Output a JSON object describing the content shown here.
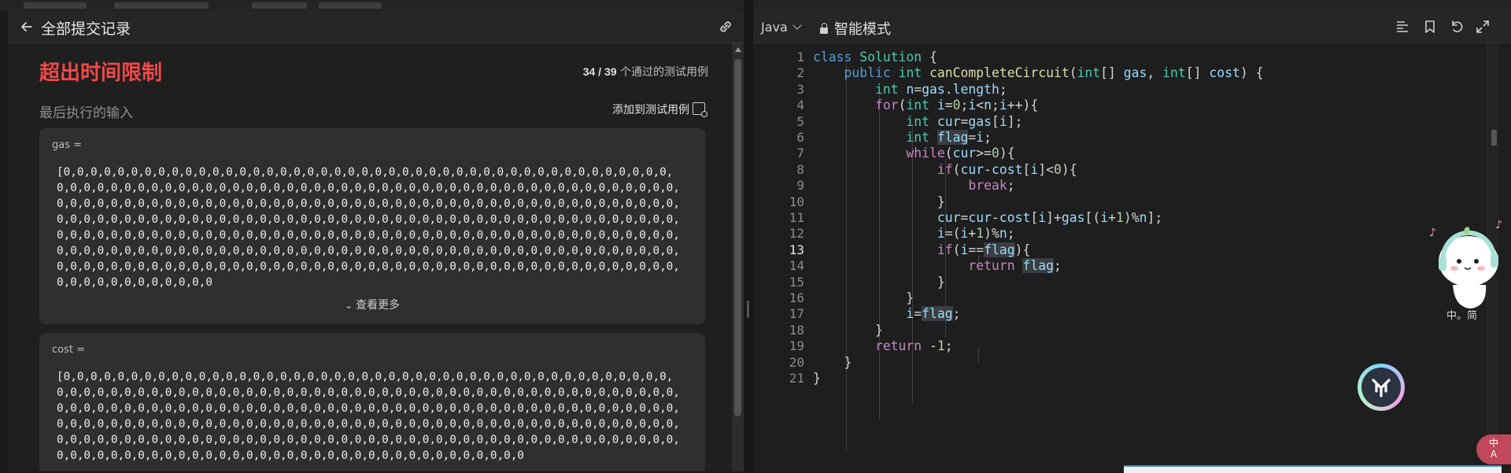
{
  "left": {
    "title": "全部提交记录",
    "verdict": "超出时间限制",
    "passed": "34 / 39",
    "passed_suffix": " 个通过的测试用例",
    "last_input_label": "最后执行的输入",
    "add_case_label": "添加到测试用例",
    "inputs": [
      {
        "name": "gas =",
        "value_prefix": "[0,0,0,0,0,0,0,0,0,0,0,0,0,0,0,0,0,0,0,0,0,0,0,0,0,0,0,0,0,0,0,0,0,0,0,0,0,0,0,0,0,0,0,0,0,0,0,0,0,0,0,0,0,0,0,0,0,0,0,0,0,0,0,0,0,0,0,0,0,0,0,0,0,0,0,0,0,0,0,0,0,0,0,0,0,0,0,0,0,0,0,0,0,0,0,0,0,0,0,0,0,0,0,0,0,0,0,0,0,0,0,0,0,0,0,0,0,0,0,0,0,0,0,0,0,0,0,0,0,0,0,0,0,0,0,0,0,0,0,0,0,0,0,0,0,0,0,0,0,0,0,0,0,0,0,0,0,0,0,0,0,0,0,0,0,0,0,0,0,0,0,0,0,0,0,0,0,0,0,0,0,0,0,0,0,0,0,0,0,0,0,0,0,0,0,0,0,0,0,0,0,0,0,0,0,0,0,0,0,0,0,0,0,0,0,0,0,0,0,0,0,0,0,0,0,0,0,0,0,0,0,0,0,0,0,0,0,0,0,0,0,0,0,0,0,0,0,0,0,0,0,0,0,0,0,0,0,0,0,0,0,0,0,0,0,0,0,0,0,0,0,0,0,0,0,0,0,0,0,0,0,0,0,0,0,0,0,0,0,0,0,0,0,0,0,0,0,0,0,0,0,0,0,0,0,0,0,0,0,0,0,0,0,0,0,0,0,0,0,0,0,0,0,0,0,0,0,0,0,0,0,0,0"
      },
      {
        "name": "cost =",
        "value_prefix": "[0,0,0,0,0,0,0,0,0,0,0,0,0,0,0,0,0,0,0,0,0,0,0,0,0,0,0,0,0,0,0,0,0,0,0,0,0,0,0,0,0,0,0,0,0,0,0,0,0,0,0,0,0,0,0,0,0,0,0,0,0,0,0,0,0,0,0,0,0,0,0,0,0,0,0,0,0,0,0,0,0,0,0,0,0,0,0,0,0,0,0,0,0,0,0,0,0,0,0,0,0,0,0,0,0,0,0,0,0,0,0,0,0,0,0,0,0,0,0,0,0,0,0,0,0,0,0,0,0,0,0,0,0,0,0,0,0,0,0,0,0,0,0,0,0,0,0,0,0,0,0,0,0,0,0,0,0,0,0,0,0,0,0,0,0,0,0,0,0,0,0,0,0,0,0,0,0,0,0,0,0,0,0,0,0,0,0,0,0,0,0,0,0,0,0,0,0,0,0,0,0,0,0,0,0,0,0,0,0,0,0,0,0,0,0,0,0,0,0,0,0,0,0,0,0,0,0,0,0,0,0,0,0,0,0,0,0,0,0,0,0,0,0,0,0,0,0,0,0,0,0,0,0,0,0,0,0,0,0,0,0,0,0,0"
      }
    ],
    "show_more": "查看更多"
  },
  "editor": {
    "language": "Java",
    "mode": "智能模式",
    "active_line": 13,
    "icons": [
      "format-icon",
      "bookmark-icon",
      "reset-icon",
      "expand-icon"
    ],
    "line_numbers": [
      "1",
      "2",
      "3",
      "4",
      "5",
      "6",
      "7",
      "8",
      "9",
      "10",
      "11",
      "12",
      "13",
      "14",
      "15",
      "16",
      "17",
      "18",
      "19",
      "20",
      "21"
    ],
    "lines": [
      "class Solution {",
      "    public int canCompleteCircuit(int[] gas, int[] cost) {",
      "        int n=gas.length;",
      "        for(int i=0;i<n;i++){",
      "            int cur=gas[i];",
      "            int flag=i;",
      "            while(cur>=0){",
      "                if(cur-cost[i]<0){",
      "                    break;",
      "                }",
      "                cur=cur-cost[i]+gas[(i+1)%n];",
      "                i=(i+1)%n;",
      "                if(i==flag){",
      "                    return flag;",
      "                }",
      "            }",
      "            i=flag;",
      "        }",
      "        return -1;",
      "    }",
      "}"
    ]
  },
  "widgets": {
    "translate_label": "中\nA",
    "mascot_text": "中。简"
  },
  "colors": {
    "verdict": "#f24848",
    "keyword": "#c586c0",
    "type": "#4ec9b0",
    "function": "#dcdcaa",
    "variable": "#9cdcfe",
    "number": "#b5cea8"
  }
}
